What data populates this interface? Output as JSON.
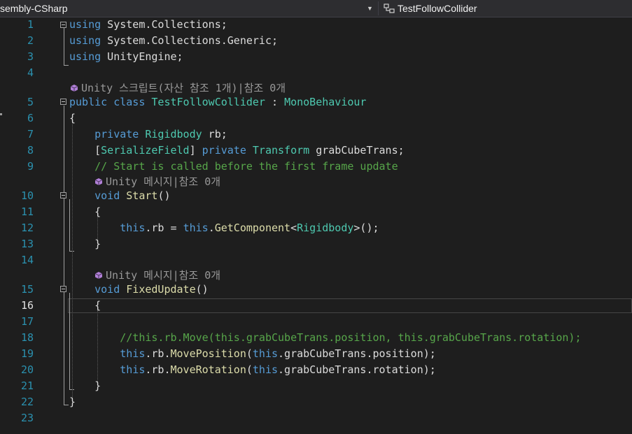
{
  "nav": {
    "project": "sembly-CSharp",
    "class": "TestFollowCollider"
  },
  "code_lens": {
    "class_lens": "Unity 스크립트(자산 참조 1개)|참조 0개",
    "start_lens": "Unity 메시지|참조 0개",
    "fixed_lens": "Unity 메시지|참조 0개"
  },
  "active_line": 16,
  "lines": [
    {
      "n": "1",
      "t": [
        [
          "using",
          "kw"
        ],
        [
          " System.Collections;",
          "pl"
        ]
      ]
    },
    {
      "n": "2",
      "t": [
        [
          "using",
          "kw"
        ],
        [
          " System.Collections.Generic;",
          "pl"
        ]
      ]
    },
    {
      "n": "3",
      "t": [
        [
          "using",
          "kw"
        ],
        [
          " UnityEngine;",
          "pl"
        ]
      ]
    },
    {
      "n": "4",
      "t": []
    },
    {
      "n": "5",
      "t": [
        [
          "public",
          "kw"
        ],
        [
          " ",
          "pl"
        ],
        [
          "class",
          "kw"
        ],
        [
          " ",
          "pl"
        ],
        [
          "TestFollowCollider",
          "ty"
        ],
        [
          " : ",
          "pl"
        ],
        [
          "MonoBehaviour",
          "ty"
        ]
      ]
    },
    {
      "n": "6",
      "t": [
        [
          "{",
          "pl"
        ]
      ]
    },
    {
      "n": "7",
      "t": [
        [
          "    ",
          "pl"
        ],
        [
          "private",
          "kw"
        ],
        [
          " ",
          "pl"
        ],
        [
          "Rigidbody",
          "ty"
        ],
        [
          " rb;",
          "pl"
        ]
      ]
    },
    {
      "n": "8",
      "t": [
        [
          "    [",
          "pl"
        ],
        [
          "SerializeField",
          "ty"
        ],
        [
          "] ",
          "pl"
        ],
        [
          "private",
          "kw"
        ],
        [
          " ",
          "pl"
        ],
        [
          "Transform",
          "ty"
        ],
        [
          " grabCubeTrans;",
          "pl"
        ]
      ]
    },
    {
      "n": "9",
      "t": [
        [
          "    ",
          "pl"
        ],
        [
          "// Start is called before the first frame update",
          "cm"
        ]
      ]
    },
    {
      "n": "10",
      "t": [
        [
          "    ",
          "pl"
        ],
        [
          "void",
          "kw"
        ],
        [
          " ",
          "pl"
        ],
        [
          "Start",
          "fn"
        ],
        [
          "()",
          "pl"
        ]
      ]
    },
    {
      "n": "11",
      "t": [
        [
          "    {",
          "pl"
        ]
      ]
    },
    {
      "n": "12",
      "t": [
        [
          "        ",
          "pl"
        ],
        [
          "this",
          "kw"
        ],
        [
          ".rb = ",
          "pl"
        ],
        [
          "this",
          "kw"
        ],
        [
          ".",
          "pl"
        ],
        [
          "GetComponent",
          "fn"
        ],
        [
          "<",
          "pl"
        ],
        [
          "Rigidbody",
          "ty"
        ],
        [
          ">();",
          "pl"
        ]
      ]
    },
    {
      "n": "13",
      "t": [
        [
          "    }",
          "pl"
        ]
      ]
    },
    {
      "n": "14",
      "t": []
    },
    {
      "n": "15",
      "t": [
        [
          "    ",
          "pl"
        ],
        [
          "void",
          "kw"
        ],
        [
          " ",
          "pl"
        ],
        [
          "FixedUpdate",
          "fn"
        ],
        [
          "()",
          "pl"
        ]
      ]
    },
    {
      "n": "16",
      "t": [
        [
          "    {",
          "pl"
        ]
      ]
    },
    {
      "n": "17",
      "t": []
    },
    {
      "n": "18",
      "t": [
        [
          "        ",
          "pl"
        ],
        [
          "//this.rb.Move(this.grabCubeTrans.position, this.grabCubeTrans.rotation);",
          "cm"
        ]
      ]
    },
    {
      "n": "19",
      "t": [
        [
          "        ",
          "pl"
        ],
        [
          "this",
          "kw"
        ],
        [
          ".rb.",
          "pl"
        ],
        [
          "MovePosition",
          "fn"
        ],
        [
          "(",
          "pl"
        ],
        [
          "this",
          "kw"
        ],
        [
          ".grabCubeTrans.position);",
          "pl"
        ]
      ]
    },
    {
      "n": "20",
      "t": [
        [
          "        ",
          "pl"
        ],
        [
          "this",
          "kw"
        ],
        [
          ".rb.",
          "pl"
        ],
        [
          "MoveRotation",
          "fn"
        ],
        [
          "(",
          "pl"
        ],
        [
          "this",
          "kw"
        ],
        [
          ".grabCubeTrans.rotation);",
          "pl"
        ]
      ]
    },
    {
      "n": "21",
      "t": [
        [
          "    }",
          "pl"
        ]
      ]
    },
    {
      "n": "22",
      "t": [
        [
          "}",
          "pl"
        ]
      ]
    },
    {
      "n": "23",
      "t": []
    }
  ]
}
